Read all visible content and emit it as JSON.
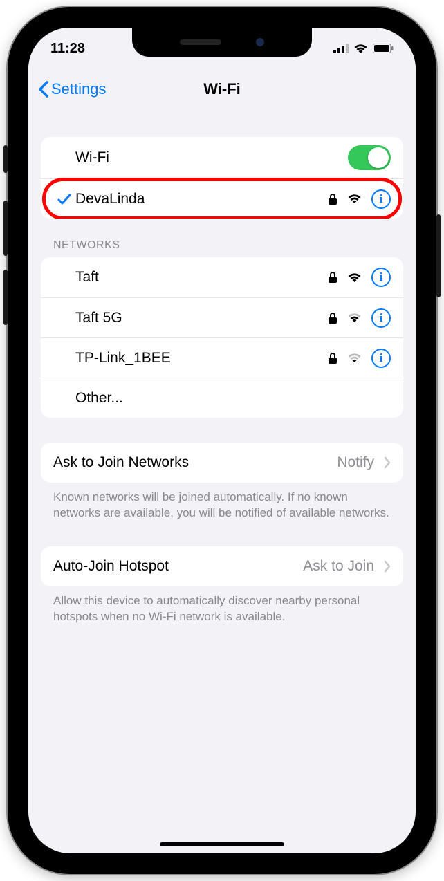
{
  "statusbar": {
    "time": "11:28"
  },
  "nav": {
    "back": "Settings",
    "title": "Wi-Fi"
  },
  "wifi_toggle": {
    "label": "Wi-Fi",
    "on": true
  },
  "connected": {
    "name": "DevaLinda"
  },
  "networks_header": "NETWORKS",
  "networks": [
    {
      "name": "Taft"
    },
    {
      "name": "Taft 5G"
    },
    {
      "name": "TP-Link_1BEE"
    }
  ],
  "other_label": "Other...",
  "ask_join": {
    "label": "Ask to Join Networks",
    "value": "Notify"
  },
  "ask_join_footer": "Known networks will be joined automatically. If no known networks are available, you will be notified of available networks.",
  "auto_hotspot": {
    "label": "Auto-Join Hotspot",
    "value": "Ask to Join"
  },
  "auto_hotspot_footer": "Allow this device to automatically discover nearby personal hotspots when no Wi-Fi network is available."
}
